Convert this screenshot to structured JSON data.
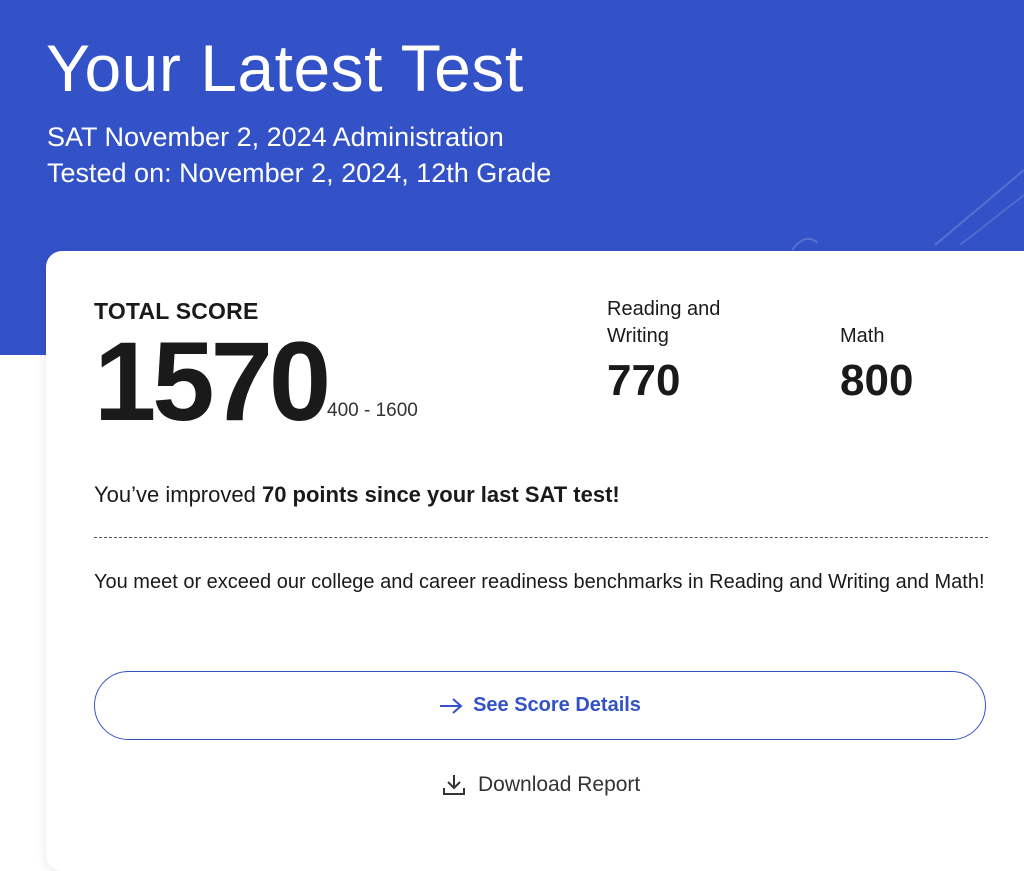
{
  "header": {
    "title": "Your Latest Test",
    "test_name": "SAT November 2, 2024 Administration",
    "tested_on": "Tested on: November 2, 2024, 12th Grade",
    "background_color": "#3352c7"
  },
  "score_card": {
    "total_label": "TOTAL SCORE",
    "total_score": "1570",
    "score_range": "400 - 1600",
    "sections": [
      {
        "label": "Reading and Writing",
        "score": "770"
      },
      {
        "label": "Math",
        "score": "800"
      }
    ],
    "improvement": {
      "prefix": "You’ve improved ",
      "highlight": "70 points since your last SAT test!"
    },
    "benchmark_message": "You meet or exceed our college and career readiness benchmarks in Reading and Writing and Math!",
    "details_button": {
      "label": "See Score Details",
      "icon": "arrow-right-icon"
    },
    "download_link": {
      "label": "Download Report",
      "icon": "download-icon"
    },
    "accent_color": "#3352c7"
  }
}
